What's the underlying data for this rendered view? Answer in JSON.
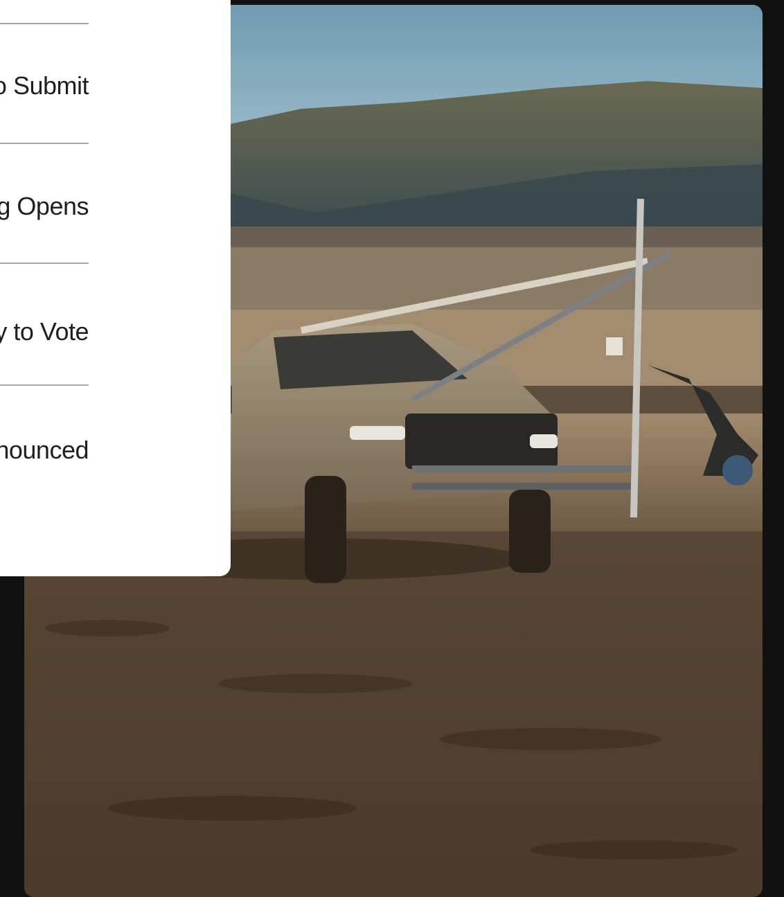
{
  "menu": {
    "items": [
      {
        "label": "How to Submit"
      },
      {
        "label": "Voting Opens"
      },
      {
        "label": "Ready to Vote"
      },
      {
        "label": "Winners Announced"
      }
    ]
  },
  "hero": {
    "description": "Photo of a pickup truck with a camera crane arm driving across a desert plain",
    "colors": {
      "sky": "#7fa6b8",
      "mountains": "#4a5a58",
      "ground": "#5a4632",
      "truck": "#9a8a72"
    }
  },
  "page": {
    "background": "#111111"
  }
}
